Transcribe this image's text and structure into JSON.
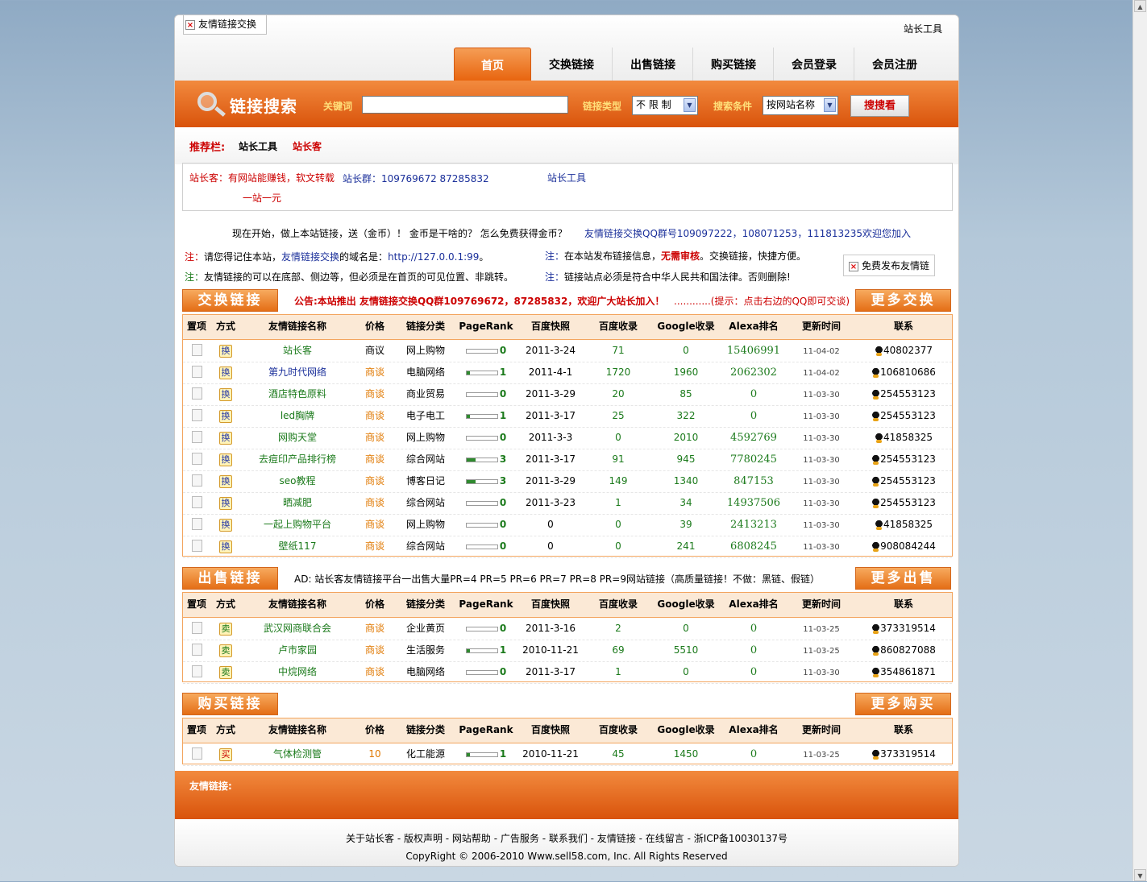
{
  "header": {
    "logo_alt": "友情链接交换",
    "top_link": "站长工具",
    "nav": [
      {
        "label": "首页",
        "active": true
      },
      {
        "label": "交换链接"
      },
      {
        "label": "出售链接"
      },
      {
        "label": "购买链接"
      },
      {
        "label": "会员登录"
      },
      {
        "label": "会员注册"
      }
    ]
  },
  "search": {
    "title": "链接搜索",
    "keyword_label": "关键词",
    "keyword_value": "",
    "type_label": "链接类型",
    "type_value": "不 限 制",
    "cond_label": "搜索条件",
    "cond_value": "按网站名称",
    "button": "搜搜看"
  },
  "recommend": {
    "title": "推荐栏:",
    "links": [
      "站长工具",
      "站长客"
    ],
    "box_line1_a": "站长客：有网站能赚钱，软文转载",
    "box_line1_b": "站长群：109769672   87285832",
    "box_line1_c": "站长工具",
    "box_line2": "一站一元"
  },
  "info": {
    "line1_a": "现在开始，做上本站链接，送（金币）！  金币是干啥的？  怎么免费获得金币？",
    "line1_b": "友情链接交换QQ群号109097222，108071253，111813235欢迎您加入",
    "note_prefix": "注：",
    "l2_a": "请您得记住本站，",
    "l2_b": "友情链接交换",
    "l2_c": "的域名是：",
    "l2_d": "http://127.0.0.1:99",
    "l2_e": "。",
    "l3": "友情链接的可以在底部、侧边等，但必须是在首页的可见位置、非跳转。",
    "r2_a": "在本站发布链接信息，",
    "r2_b": "无需审核",
    "r2_c": "。交换链接，快捷方便。",
    "r3": "链接站点必须是符合中华人民共和国法律。否则删除!",
    "free_publish": "免费发布友情链"
  },
  "columns": [
    "置项",
    "方式",
    "友情链接名称",
    "价格",
    "链接分类",
    "PageRank",
    "百度快照",
    "百度收录",
    "Google收录",
    "Alexa排名",
    "更新时间",
    "联系"
  ],
  "exchange": {
    "button": "交换链接",
    "more": "更多交换",
    "notice_a": "公告:本站推出 友情链接交换QQ群109769672，87285832，欢迎广大站长加入！",
    "notice_b": "............(提示：点击右边的QQ即可交谈)",
    "rows": [
      {
        "mode": "换",
        "name": "站长客",
        "price": "商议",
        "cat": "网上购物",
        "pr": 0,
        "snap": "2011-3-24",
        "baidu": "71",
        "google": "0",
        "alexa": "15406991",
        "updated": "11-04-02",
        "qq": "40802377"
      },
      {
        "mode": "换",
        "name": "第九时代网络",
        "price": "商谈",
        "cat": "电脑网络",
        "pr": 1,
        "snap": "2011-4-1",
        "baidu": "1720",
        "google": "1960",
        "alexa": "2062302",
        "updated": "11-04-02",
        "qq": "106810686"
      },
      {
        "mode": "换",
        "name": "酒店特色原料",
        "price": "商谈",
        "cat": "商业贸易",
        "pr": 0,
        "snap": "2011-3-29",
        "baidu": "20",
        "google": "85",
        "alexa": "0",
        "updated": "11-03-30",
        "qq": "254553123"
      },
      {
        "mode": "换",
        "name": "led胸牌",
        "price": "商谈",
        "cat": "电子电工",
        "pr": 1,
        "snap": "2011-3-17",
        "baidu": "25",
        "google": "322",
        "alexa": "0",
        "updated": "11-03-30",
        "qq": "254553123"
      },
      {
        "mode": "换",
        "name": "网购天堂",
        "price": "商谈",
        "cat": "网上购物",
        "pr": 0,
        "snap": "2011-3-3",
        "baidu": "0",
        "google": "2010",
        "alexa": "4592769",
        "updated": "11-03-30",
        "qq": "41858325"
      },
      {
        "mode": "换",
        "name": "去痘印产品排行榜",
        "price": "商谈",
        "cat": "综合网站",
        "pr": 3,
        "snap": "2011-3-17",
        "baidu": "91",
        "google": "945",
        "alexa": "7780245",
        "updated": "11-03-30",
        "qq": "254553123"
      },
      {
        "mode": "换",
        "name": "seo教程",
        "price": "商谈",
        "cat": "博客日记",
        "pr": 3,
        "snap": "2011-3-29",
        "baidu": "149",
        "google": "1340",
        "alexa": "847153",
        "updated": "11-03-30",
        "qq": "254553123"
      },
      {
        "mode": "换",
        "name": "晒减肥",
        "price": "商谈",
        "cat": "综合网站",
        "pr": 0,
        "snap": "2011-3-23",
        "baidu": "1",
        "google": "34",
        "alexa": "14937506",
        "updated": "11-03-30",
        "qq": "254553123"
      },
      {
        "mode": "换",
        "name": "一起上购物平台",
        "price": "商谈",
        "cat": "网上购物",
        "pr": 0,
        "snap": "0",
        "baidu": "0",
        "google": "39",
        "alexa": "2413213",
        "updated": "11-03-30",
        "qq": "41858325"
      },
      {
        "mode": "换",
        "name": "壁纸117",
        "price": "商谈",
        "cat": "综合网站",
        "pr": 0,
        "snap": "0",
        "baidu": "0",
        "google": "241",
        "alexa": "6808245",
        "updated": "11-03-30",
        "qq": "908084244"
      }
    ]
  },
  "sell": {
    "button": "出售链接",
    "more": "更多出售",
    "notice": "AD: 站长客友情链接平台一出售大量PR=4 PR=5 PR=6 PR=7 PR=8 PR=9网站链接（高质量链接！不做：黑链、假链）",
    "rows": [
      {
        "mode": "卖",
        "name": "武汉网商联合会",
        "price": "商谈",
        "cat": "企业黄页",
        "pr": 0,
        "snap": "2011-3-16",
        "baidu": "2",
        "google": "0",
        "alexa": "0",
        "updated": "11-03-25",
        "qq": "373319514"
      },
      {
        "mode": "卖",
        "name": "卢市家园",
        "price": "商谈",
        "cat": "生活服务",
        "pr": 1,
        "snap": "2010-11-21",
        "baidu": "69",
        "google": "5510",
        "alexa": "0",
        "updated": "11-03-25",
        "qq": "860827088"
      },
      {
        "mode": "卖",
        "name": "中烷网络",
        "price": "商谈",
        "cat": "电脑网络",
        "pr": 0,
        "snap": "2011-3-17",
        "baidu": "1",
        "google": "0",
        "alexa": "0",
        "updated": "11-03-30",
        "qq": "354861871"
      }
    ]
  },
  "buy": {
    "button": "购买链接",
    "more": "更多购买",
    "rows": [
      {
        "mode": "买",
        "name": "气体检测管",
        "price": "10",
        "cat": "化工能源",
        "pr": 1,
        "snap": "2010-11-21",
        "baidu": "45",
        "google": "1450",
        "alexa": "0",
        "updated": "11-03-25",
        "qq": "373319514"
      }
    ]
  },
  "footer": {
    "friend_label": "友情链接:",
    "links": "关于站长客 - 版权声明 - 网站帮助 - 广告服务 - 联系我们 - 友情链接 - 在线留言 - 浙ICP备10030137号",
    "copyright": "CopyRight © 2006-2010 Www.sell58.com, Inc. All Rights Reserved"
  }
}
